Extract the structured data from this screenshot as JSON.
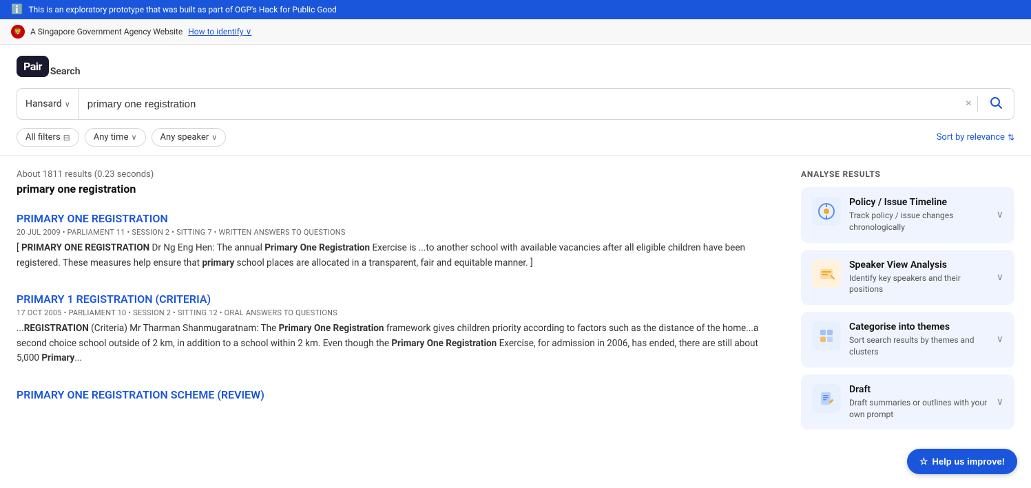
{
  "info_bar": {
    "text": "This is an exploratory prototype that was built as part of OGP's Hack for Public Good"
  },
  "gov_banner": {
    "text": "A Singapore Government Agency Website",
    "link_text": "How to identify",
    "link_arrow": "›"
  },
  "logo": {
    "box_text": "Pair",
    "label": "Search"
  },
  "search": {
    "source": "Hansard",
    "query": "primary one registration",
    "clear_label": "×",
    "search_icon": "🔍"
  },
  "filters": {
    "all_filters_label": "All filters",
    "any_time_label": "Any time",
    "any_speaker_label": "Any speaker"
  },
  "sort": {
    "label": "Sort by relevance"
  },
  "results": {
    "meta": "About 1811 results (0.23 seconds)",
    "query_label": "primary one registration",
    "items": [
      {
        "title": "PRIMARY ONE REGISTRATION",
        "meta": "20 JUL 2009 • PARLIAMENT 11 • SESSION 2 • SITTING 7 • WRITTEN ANSWERS TO QUESTIONS",
        "snippet_html": "[ <strong>PRIMARY ONE REGISTRATION</strong> Dr Ng Eng Hen: The annual <strong>Primary One Registration</strong> Exercise is ...to another school with available vacancies after all eligible children have been registered. These measures help ensure that <strong>primary</strong> school places are allocated in a transparent, fair and equitable manner. ]"
      },
      {
        "title": "PRIMARY 1 REGISTRATION (CRITERIA)",
        "meta": "17 OCT 2005 • PARLIAMENT 10 • SESSION 2 • SITTING 12 • ORAL ANSWERS TO QUESTIONS",
        "snippet_html": "...<strong>REGISTRATION</strong> (Criteria) Mr Tharman Shanmugaratnam: The <strong>Primary One Registration</strong> framework gives children priority according to factors such as the distance of the home...a second choice school outside of 2 km, in addition to a school within 2 km. Even though the <strong>Primary One Registration</strong> Exercise, for admission in 2006, has ended, there are still about 5,000 <strong>Primary</strong>..."
      },
      {
        "title": "PRIMARY ONE REGISTRATION SCHEME (REVIEW)",
        "meta": "",
        "snippet_html": ""
      }
    ]
  },
  "analyse": {
    "header": "ANALYSE RESULTS",
    "cards": [
      {
        "id": "timeline",
        "title": "Policy / Issue Timeline",
        "desc": "Track policy / issue changes chronologically",
        "icon_type": "timeline",
        "icon_char": "🔍"
      },
      {
        "id": "speaker",
        "title": "Speaker View Analysis",
        "desc": "Identify key speakers and their positions",
        "icon_type": "speaker",
        "icon_char": "📋"
      },
      {
        "id": "themes",
        "title": "Categorise into themes",
        "desc": "Sort search results by themes and clusters",
        "icon_type": "themes",
        "icon_char": "📄"
      },
      {
        "id": "draft",
        "title": "Draft",
        "desc": "Draft summaries or outlines with your own prompt",
        "icon_type": "draft",
        "icon_char": "✏️"
      }
    ]
  },
  "help_button": {
    "label": "Help us improve!"
  }
}
